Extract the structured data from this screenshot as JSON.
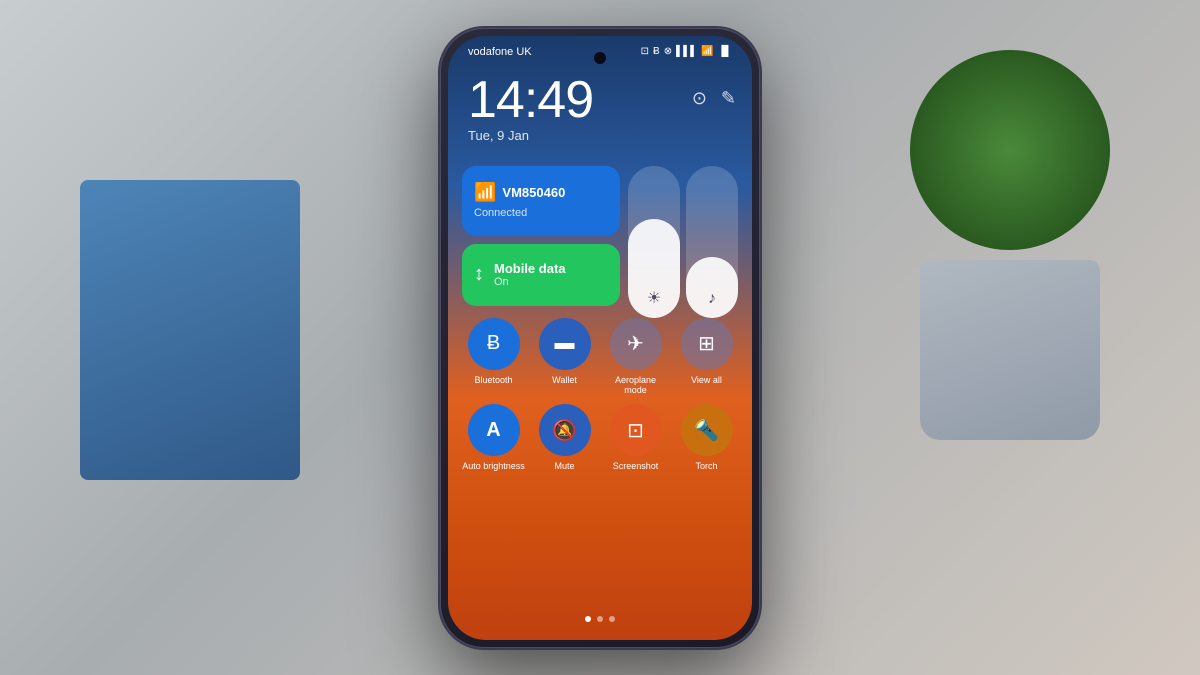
{
  "scene": {
    "background": "blurred desk scene with teal/blue storage box and metal plant pot"
  },
  "phone": {
    "status_bar": {
      "carrier": "vodafone UK",
      "icons": [
        "nfc",
        "bluetooth",
        "alarm",
        "signal",
        "wifi",
        "battery"
      ]
    },
    "time": "14:49",
    "date": "Tue, 9 Jan",
    "edit_icons": [
      "brightness-icon",
      "edit-icon"
    ],
    "wifi_tile": {
      "name": "VM850460",
      "status": "Connected",
      "icon": "wifi"
    },
    "sliders": [
      {
        "id": "brightness-slider",
        "icon": "☀",
        "fill_percent": 65
      },
      {
        "id": "volume-slider",
        "icon": "♪",
        "fill_percent": 40
      }
    ],
    "mobile_tile": {
      "name": "Mobile data",
      "status": "On",
      "icon": "signal-bars"
    },
    "quick_actions_row1": [
      {
        "id": "bluetooth",
        "label": "Bluetooth",
        "icon": "Ƀ",
        "color": "c-blue"
      },
      {
        "id": "wallet",
        "label": "Wallet",
        "icon": "▬",
        "color": "c-blue2"
      },
      {
        "id": "aeroplane",
        "label": "Aeroplane mode",
        "icon": "✈",
        "color": "c-gray-blue"
      },
      {
        "id": "view-all",
        "label": "View all",
        "icon": "⊞",
        "color": "c-gray-blue"
      }
    ],
    "quick_actions_row2": [
      {
        "id": "auto-brightness",
        "label": "Auto brightness",
        "icon": "A",
        "color": "c-blue"
      },
      {
        "id": "mute",
        "label": "Mute",
        "icon": "🔕",
        "color": "c-blue2"
      },
      {
        "id": "screenshot",
        "label": "Screenshot",
        "icon": "⊡",
        "color": "c-orange"
      },
      {
        "id": "torch",
        "label": "Torch",
        "icon": "🔦",
        "color": "c-orange2"
      }
    ],
    "pagination_dots": [
      {
        "active": true
      },
      {
        "active": false
      },
      {
        "active": false
      }
    ]
  }
}
